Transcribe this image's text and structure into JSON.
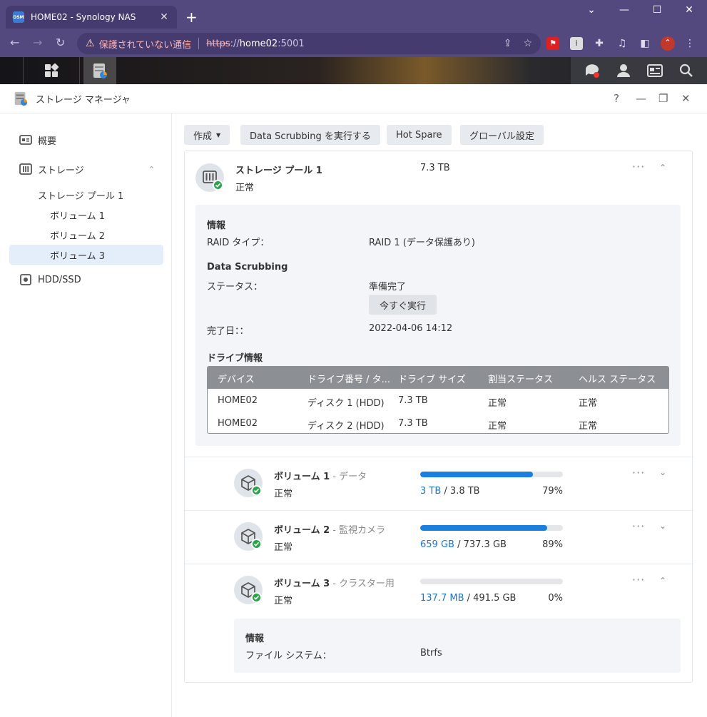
{
  "browser": {
    "tab_title": "HOME02 - Synology NAS",
    "favicon_text": "DSM",
    "security_warning": "保護されていない通信",
    "url_scheme": "https",
    "url_sep": "://",
    "url_host": "home02",
    "url_port": ":5001"
  },
  "window": {
    "title": "ストレージ マネージャ",
    "help": "?"
  },
  "sidebar": {
    "overview": "概要",
    "storage": "ストレージ",
    "pool": "ストレージ プール 1",
    "vol1": "ボリューム 1",
    "vol2": "ボリューム 2",
    "vol3": "ボリューム 3",
    "hdd": "HDD/SSD"
  },
  "toolbar": {
    "create": "作成",
    "scrub": "Data Scrubbing を実行する",
    "hotspare": "Hot Spare",
    "global": "グローバル設定"
  },
  "pool": {
    "name": "ストレージ プール 1",
    "size": "7.3 TB",
    "status": "正常",
    "info_title": "情報",
    "raid_label": "RAID タイプ：",
    "raid_value": "RAID 1 (データ保護あり)",
    "scrub_title": "Data Scrubbing",
    "scrub_status_label": "ステータス：",
    "scrub_status_value": "準備完了",
    "run_now": "今すぐ実行",
    "done_label": "完了日：：",
    "done_value": "2022-04-06 14:12",
    "drive_title": "ドライブ情報",
    "columns": [
      "デバイス",
      "ドライブ番号 / タ...",
      "ドライブ サイズ",
      "割当ステータス",
      "ヘルス ステータス"
    ],
    "rows": [
      [
        "HOME02",
        "ディスク 1 (HDD)",
        "7.3 TB",
        "正常",
        "正常"
      ],
      [
        "HOME02",
        "ディスク 2 (HDD)",
        "7.3 TB",
        "正常",
        "正常"
      ]
    ]
  },
  "volumes": [
    {
      "name": "ボリューム 1",
      "desc": "- データ",
      "status": "正常",
      "used": "3 TB",
      "total": "/ 3.8 TB",
      "pct": "79%",
      "fill": 0.79
    },
    {
      "name": "ボリューム 2",
      "desc": "- 監視カメラ",
      "status": "正常",
      "used": "659 GB",
      "total": "/ 737.3 GB",
      "pct": "89%",
      "fill": 0.89
    },
    {
      "name": "ボリューム 3",
      "desc": "- クラスター用",
      "status": "正常",
      "used": "137.7 MB",
      "total": "/ 491.5 GB",
      "pct": "0%",
      "fill": 0.0
    }
  ],
  "vol3_info": {
    "title": "情報",
    "fs_label": "ファイル システム：",
    "fs_value": "Btrfs"
  },
  "colors": {
    "accent": "#1b7fe0",
    "ok": "#2a9b3c",
    "chrome": "#54497e"
  }
}
